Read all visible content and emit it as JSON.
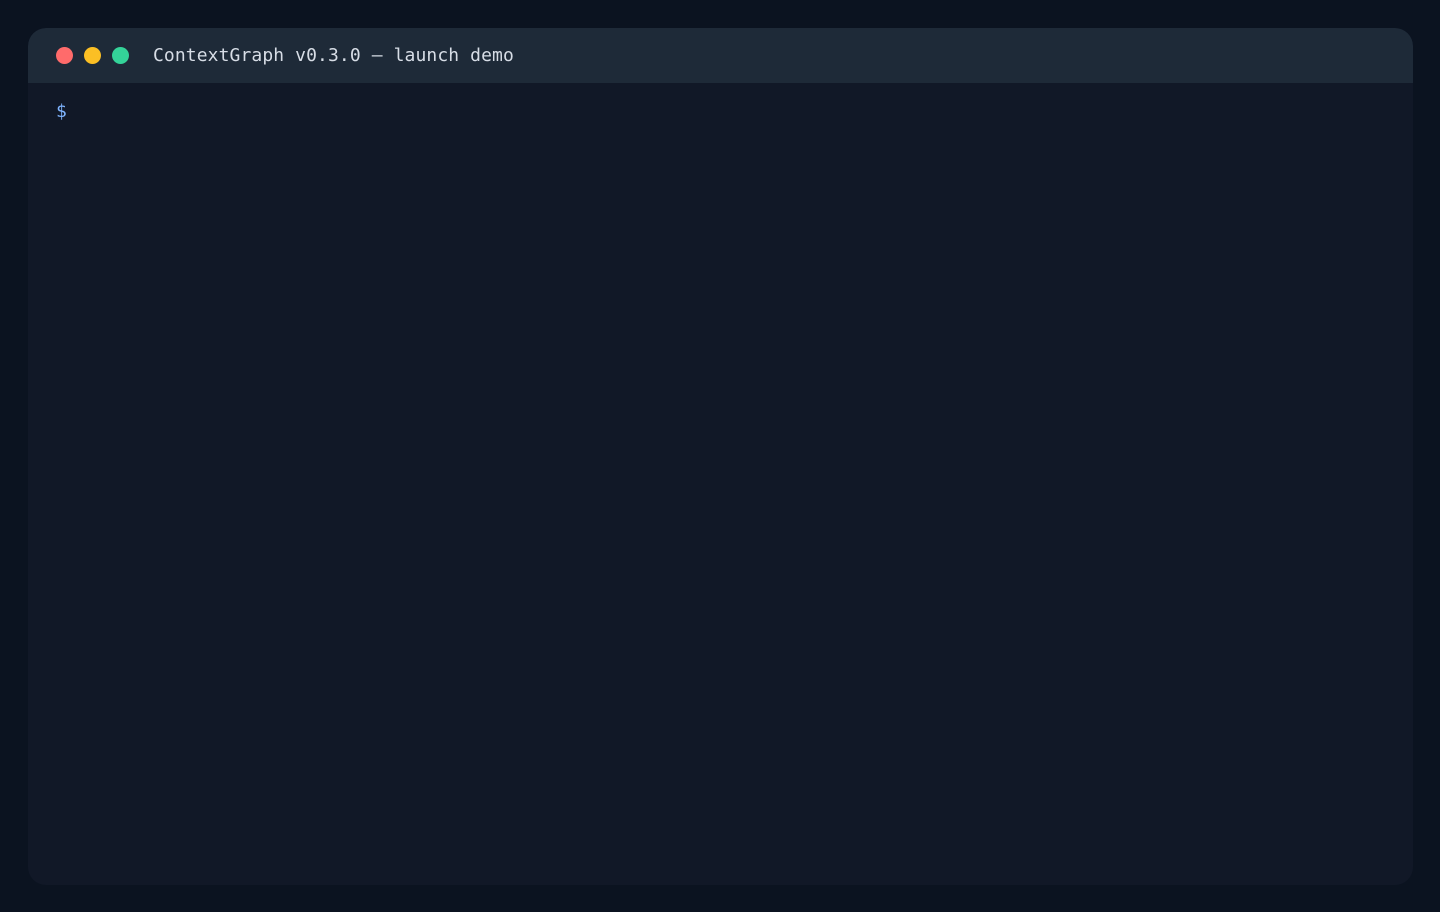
{
  "window": {
    "title": "ContextGraph v0.3.0 — launch demo",
    "traffic_lights": [
      {
        "name": "close",
        "color": "#ff6b6b"
      },
      {
        "name": "minimize",
        "color": "#fbbf24"
      },
      {
        "name": "maximize",
        "color": "#34d399"
      }
    ]
  },
  "terminal": {
    "prompt": "$",
    "input": ""
  },
  "colors": {
    "page_background": "#0b1320",
    "window_background": "#111827",
    "titlebar_background": "#1e2a38",
    "title_text": "#d7dde6",
    "prompt": "#7fb4ff"
  }
}
